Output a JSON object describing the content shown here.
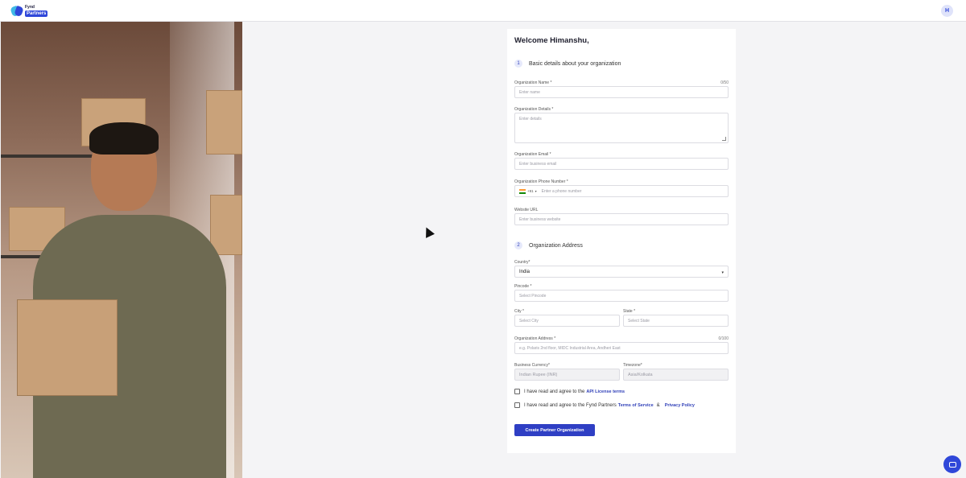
{
  "header": {
    "logo_text_top": "Fynd",
    "logo_text_bottom": "Partners",
    "avatar_initial": "H"
  },
  "form": {
    "welcome_title": "Welcome Himanshu,",
    "section1": {
      "number": "1",
      "label": "Basic details about your organization"
    },
    "org_name": {
      "label": "Organization Name *",
      "counter": "0/50",
      "placeholder": "Enter name"
    },
    "org_details": {
      "label": "Organization Details *",
      "placeholder": "Enter details"
    },
    "org_email": {
      "label": "Organization Email *",
      "placeholder": "Enter business email"
    },
    "org_phone": {
      "label": "Organization Phone Number *",
      "country_code": "+91",
      "placeholder": "Enter a phone number"
    },
    "website": {
      "label": "Website URL",
      "placeholder": "Enter business website"
    },
    "section2": {
      "number": "2",
      "label": "Organization Address"
    },
    "country": {
      "label": "Country*",
      "value": "India"
    },
    "pincode": {
      "label": "Pincode *",
      "placeholder": "Select Pincode"
    },
    "city": {
      "label": "City *",
      "placeholder": "Select City"
    },
    "state": {
      "label": "State *",
      "placeholder": "Select State"
    },
    "org_address": {
      "label": "Organization Address *",
      "counter": "0/100",
      "placeholder": "e.g. Polaris 2nd floor, MIDC Industrial Area, Andheri East"
    },
    "currency": {
      "label": "Business Currency*",
      "value": "Indian Rupee (INR)"
    },
    "timezone": {
      "label": "Timezone*",
      "value": "Asia/Kolkata"
    },
    "agree_api": {
      "text": "I have read and agree to the",
      "link": "API License terms"
    },
    "agree_terms": {
      "text": "I have read and agree to the Fynd Partners",
      "link1": "Terms of Service",
      "amp": "&",
      "link2": "Privacy Policy"
    },
    "submit_label": "Create Partner Organization"
  },
  "colors": {
    "primary": "#2f3fc4",
    "accent_blue": "#2f47d9"
  },
  "icons": {
    "chat": "chat-icon",
    "flag": "india-flag-icon"
  }
}
